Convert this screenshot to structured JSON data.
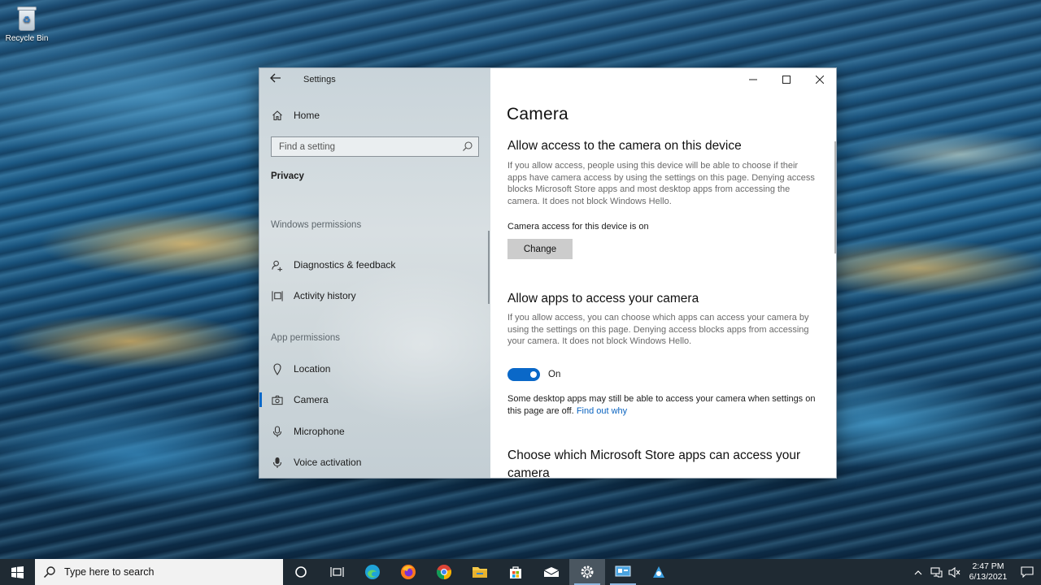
{
  "desktop": {
    "recycle_bin_label": "Recycle Bin"
  },
  "window": {
    "app_title": "Settings",
    "controls": {
      "minimize": "—",
      "maximize": "☐",
      "close": "✕"
    }
  },
  "sidebar": {
    "home_label": "Home",
    "search_placeholder": "Find a setting",
    "category": "Privacy",
    "windows_permissions_header": "Windows permissions",
    "windows_permissions_items": [
      {
        "label": "Diagnostics & feedback",
        "icon": "diagnostics-icon"
      },
      {
        "label": "Activity history",
        "icon": "activity-history-icon"
      }
    ],
    "app_permissions_header": "App permissions",
    "app_permissions_items": [
      {
        "label": "Location",
        "icon": "location-icon"
      },
      {
        "label": "Camera",
        "icon": "camera-icon",
        "active": true
      },
      {
        "label": "Microphone",
        "icon": "microphone-icon"
      },
      {
        "label": "Voice activation",
        "icon": "voice-activation-icon"
      }
    ]
  },
  "content": {
    "title": "Camera",
    "section1": {
      "heading": "Allow access to the camera on this device",
      "description": "If you allow access, people using this device will be able to choose if their apps have camera access by using the settings on this page. Denying access blocks Microsoft Store apps and most desktop apps from accessing the camera. It does not block Windows Hello.",
      "status": "Camera access for this device is on",
      "button_label": "Change"
    },
    "section2": {
      "heading": "Allow apps to access your camera",
      "description": "If you allow access, you can choose which apps can access your camera by using the settings on this page. Denying access blocks apps from accessing your camera. It does not block Windows Hello.",
      "toggle_state": "On",
      "toggle_on": true,
      "note": "Some desktop apps may still be able to access your camera when settings on this page are off.",
      "link": "Find out why"
    },
    "section3": {
      "heading": "Choose which Microsoft Store apps can access your camera"
    }
  },
  "taskbar": {
    "search_placeholder": "Type here to search",
    "pinned": [
      "cortana-icon",
      "task-view-icon",
      "edge-icon",
      "firefox-icon",
      "chrome-icon",
      "file-explorer-icon",
      "store-icon",
      "mail-icon",
      "settings-icon",
      "control-panel-icon",
      "app-icon"
    ],
    "time": "2:47 PM",
    "date": "6/13/2021"
  },
  "colors": {
    "accent": "#0a68c8",
    "link": "#0b64c0",
    "taskbar": "#1f2a33"
  }
}
